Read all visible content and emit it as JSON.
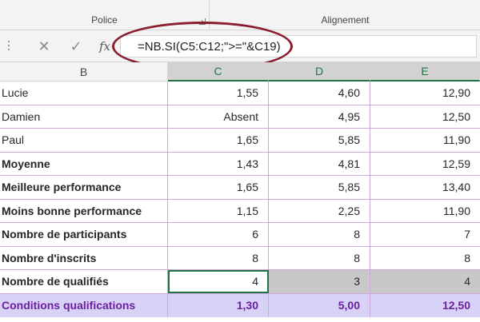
{
  "ribbon": {
    "groups": [
      {
        "label": "Police"
      },
      {
        "label": "Alignement"
      }
    ]
  },
  "formula_bar": {
    "cancel_icon": "✕",
    "enter_icon": "✓",
    "fx_label": "fx",
    "formula": "=NB.SI(C5:C12;\">=\"&C19)",
    "highlight_color": "#8b1e2e"
  },
  "columns": [
    "B",
    "C",
    "D",
    "E"
  ],
  "rows": [
    {
      "label": "Lucie",
      "c": "1,55",
      "d": "4,60",
      "e": "12,90",
      "style": "normal"
    },
    {
      "label": "Damien",
      "c": "Absent",
      "d": "4,95",
      "e": "12,50",
      "style": "normal"
    },
    {
      "label": "Paul",
      "c": "1,65",
      "d": "5,85",
      "e": "11,90",
      "style": "normal"
    },
    {
      "label": "Moyenne",
      "c": "1,43",
      "d": "4,81",
      "e": "12,59",
      "style": "bold"
    },
    {
      "label": "Meilleure performance",
      "c": "1,65",
      "d": "5,85",
      "e": "13,40",
      "style": "bold"
    },
    {
      "label": "Moins bonne performance",
      "c": "1,15",
      "d": "2,25",
      "e": "11,90",
      "style": "bold"
    },
    {
      "label": "Nombre de participants",
      "c": "6",
      "d": "8",
      "e": "7",
      "style": "bold"
    },
    {
      "label": "Nombre d'inscrits",
      "c": "8",
      "d": "8",
      "e": "8",
      "style": "bold"
    },
    {
      "label": "Nombre de qualifiés",
      "c": "4",
      "d": "3",
      "e": "4",
      "style": "qual"
    },
    {
      "label": "Conditions qualifications",
      "c": "1,30",
      "d": "5,00",
      "e": "12,50",
      "style": "cond"
    }
  ],
  "colors": {
    "excel_green": "#217346",
    "grid_line": "#c9a9dc",
    "conditions_bg": "#d9d2f7",
    "conditions_text": "#6b1fa1",
    "selected_fill": "#c8c8c8"
  }
}
